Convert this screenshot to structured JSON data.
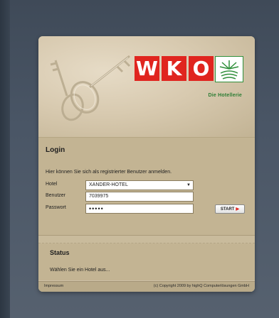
{
  "brand": {
    "letters": [
      "W",
      "K",
      "O"
    ],
    "subtitle": "Die Hotellerie",
    "red": "#e0251f",
    "green": "#2c7d34"
  },
  "login": {
    "title": "Login",
    "hint": "Hier können Sie sich als registrierter Benutzer anmelden.",
    "hotel_label": "Hotel",
    "hotel_value": "XANDER-HOTEL",
    "user_label": "Benutzer",
    "user_value": "7039975",
    "password_label": "Passwort",
    "password_value": "•••••",
    "start_label": "START"
  },
  "status": {
    "title": "Status",
    "text": "Wählen Sie ein Hotel aus..."
  },
  "footer": {
    "impressum": "Impressum",
    "copyright": "(c) Copyright 2009 by highQ Computerlösungen GmbH"
  },
  "icons": {
    "keys": "keys-illustration",
    "logo_mark": "wko-crown-icon",
    "select_arrow": "chevron-down-icon",
    "start_arrow": "arrow-right-icon"
  }
}
